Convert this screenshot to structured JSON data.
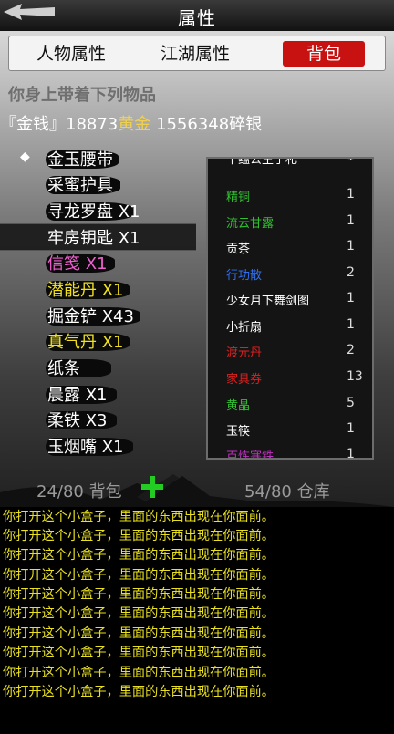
{
  "header": {
    "title": "属性"
  },
  "tabs": [
    {
      "label": "人物属性",
      "active": false
    },
    {
      "label": "江湖属性",
      "active": false
    },
    {
      "label": "背包",
      "active": true
    }
  ],
  "carry_text": "你身上带着下列物品",
  "money": {
    "label": "『金钱』",
    "gold_value": "18873",
    "gold_word": "黄金",
    "silver_value": "1556348碎银"
  },
  "left_items": [
    {
      "name": "金玉腰带",
      "color": "#ffffff",
      "equipped": true
    },
    {
      "name": "采蜜护具",
      "color": "#ffffff"
    },
    {
      "name": "寻龙罗盘 X1",
      "color": "#ffffff"
    },
    {
      "name": "牢房钥匙 X1",
      "color": "#ffffff",
      "selected": true
    },
    {
      "name": "信笺 X1",
      "color": "#f060d0"
    },
    {
      "name": "潜能丹 X1",
      "color": "#f0e020"
    },
    {
      "name": "掘金铲 X43",
      "color": "#ffffff"
    },
    {
      "name": "真气丹 X1",
      "color": "#f0e020"
    },
    {
      "name": "纸条",
      "color": "#ffffff"
    },
    {
      "name": "晨露 X1",
      "color": "#ffffff"
    },
    {
      "name": "柔铁 X3",
      "color": "#ffffff"
    },
    {
      "name": "玉烟嘴 X1",
      "color": "#ffffff"
    }
  ],
  "right_items": [
    {
      "name": "千蕴公主手札",
      "qty": "1",
      "color": "#ffffff"
    },
    {
      "name": "精铜",
      "qty": "1",
      "color": "#30c030"
    },
    {
      "name": "流云甘露",
      "qty": "1",
      "color": "#30c030"
    },
    {
      "name": "贡茶",
      "qty": "1",
      "color": "#ffffff"
    },
    {
      "name": "行功散",
      "qty": "2",
      "color": "#3070f0"
    },
    {
      "name": "少女月下舞剑图",
      "qty": "1",
      "color": "#ffffff"
    },
    {
      "name": "小折扇",
      "qty": "1",
      "color": "#ffffff"
    },
    {
      "name": "渡元丹",
      "qty": "2",
      "color": "#e02020"
    },
    {
      "name": "家具券",
      "qty": "13",
      "color": "#e02020"
    },
    {
      "name": "黄晶",
      "qty": "5",
      "color": "#30c030"
    },
    {
      "name": "玉筷",
      "qty": "1",
      "color": "#ffffff"
    },
    {
      "name": "百炼寒铁",
      "qty": "1",
      "color": "#c030c0"
    }
  ],
  "bag_count": "24/80 背包",
  "storage_count": "54/80 仓库",
  "log_lines": [
    "你打开这个小盒子，里面的东西出现在你面前。",
    "你打开这个小盒子，里面的东西出现在你面前。",
    "你打开这个小盒子，里面的东西出现在你面前。",
    "你打开这个小盒子，里面的东西出现在你面前。",
    "你打开这个小盒子，里面的东西出现在你面前。",
    "你打开这个小盒子，里面的东西出现在你面前。",
    "你打开这个小盒子，里面的东西出现在你面前。",
    "你打开这个小盒子，里面的东西出现在你面前。",
    "你打开这个小盒子，里面的东西出现在你面前。",
    "你打开这个小盒子，里面的东西出现在你面前。"
  ],
  "icons": {
    "back": "back-arrow-icon",
    "add": "plus-icon",
    "bullet": "diamond-bullet-icon"
  }
}
